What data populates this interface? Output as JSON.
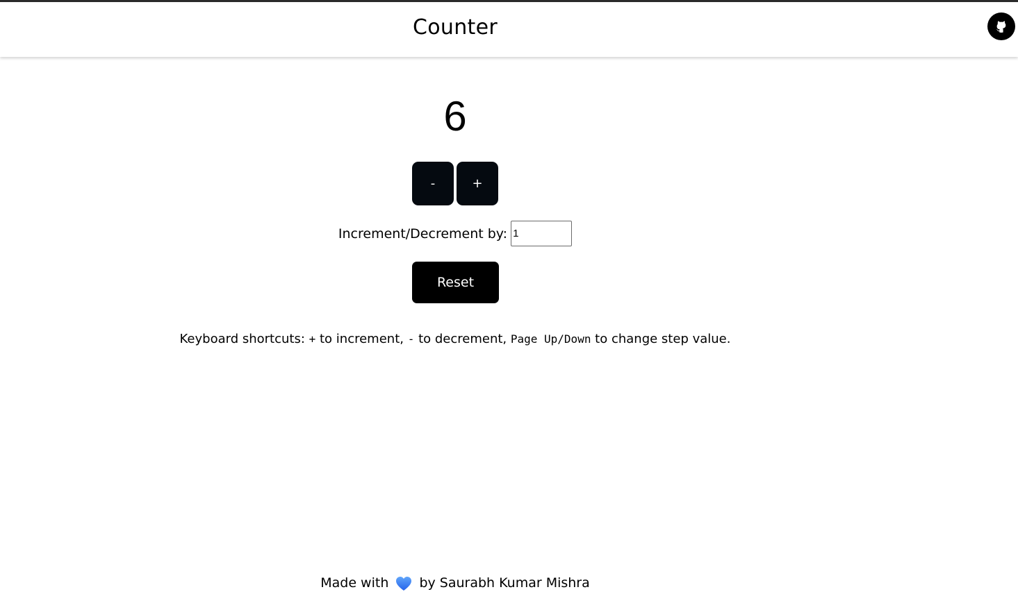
{
  "header": {
    "title": "Counter",
    "github_icon": "github-icon"
  },
  "counter": {
    "value": "6",
    "decrement_label": "-",
    "increment_label": "+",
    "step_label": "Increment/Decrement by:",
    "step_value": "1",
    "reset_label": "Reset"
  },
  "shortcuts": {
    "prefix": "Keyboard shortcuts: ",
    "plus_key": "+",
    "plus_text": " to increment, ",
    "minus_key": "-",
    "minus_text": " to decrement, ",
    "page_key": "Page Up/Down",
    "page_text": " to change step value."
  },
  "footer": {
    "made_with": "Made with",
    "by_text": "by Saurabh Kumar Mishra",
    "heart_icon": "heart-icon",
    "heart_color": "#3b82f6"
  },
  "colors": {
    "button_bg": "#050a10",
    "reset_bg": "#000000"
  }
}
